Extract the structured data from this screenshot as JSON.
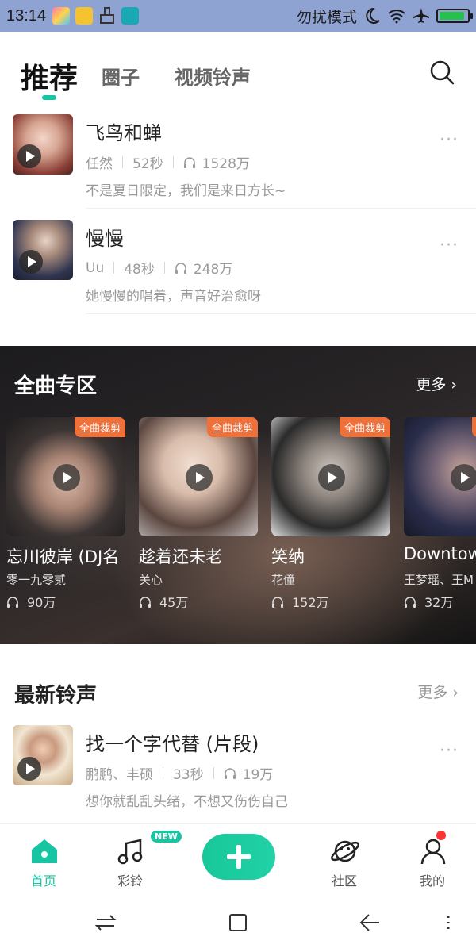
{
  "status_bar": {
    "time": "13:14",
    "right_text": "勿扰模式",
    "icons": [
      "app-icon",
      "folder-icon",
      "broom-icon",
      "usb-icon",
      "moon-icon",
      "wifi-icon",
      "airplane-icon",
      "battery-icon"
    ],
    "battery_level": 0.9
  },
  "tabs": [
    {
      "label": "推荐",
      "active": true
    },
    {
      "label": "圈子",
      "active": false
    },
    {
      "label": "视频铃声",
      "active": false
    }
  ],
  "recommended": [
    {
      "title": "飞鸟和蝉",
      "artist": "任然",
      "duration": "52秒",
      "plays": "1528万",
      "desc": "不是夏日限定，我们是来日方长~"
    },
    {
      "title": "慢慢",
      "artist": "Uu",
      "duration": "48秒",
      "plays": "248万",
      "desc": "她慢慢的唱着，声音好治愈呀"
    }
  ],
  "full_section": {
    "title": "全曲专区",
    "more": "更多",
    "tag": "全曲裁剪",
    "cards": [
      {
        "title": "忘川彼岸 (DJ名",
        "artist": "零一九零贰",
        "plays": "90万"
      },
      {
        "title": "趁着还未老",
        "artist": "关心",
        "plays": "45万"
      },
      {
        "title": "笑纳",
        "artist": "花僮",
        "plays": "152万"
      },
      {
        "title": "Downtow",
        "artist": "王梦瑶、王M",
        "plays": "32万"
      }
    ]
  },
  "new_ringtones": {
    "title": "最新铃声",
    "more": "更多",
    "items": [
      {
        "title": "找一个字代替 (片段)",
        "artist": "鹏鹏、丰硕",
        "duration": "33秒",
        "plays": "19万",
        "desc": "想你就乱乱头绪，不想又伤伤自己"
      }
    ]
  },
  "bottom_nav": {
    "home": "首页",
    "ringtone": "彩铃",
    "new_badge": "NEW",
    "community": "社区",
    "mine": "我的"
  },
  "colors": {
    "accent": "#18c5a3",
    "tag": "#f0703a",
    "status_bar": "#8fa3d2"
  }
}
